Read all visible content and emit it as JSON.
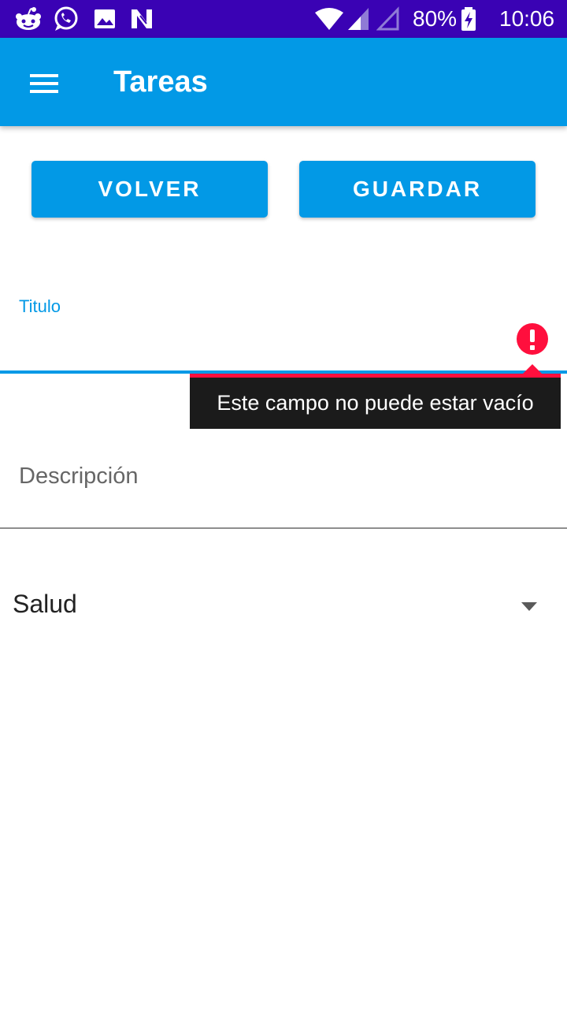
{
  "status_bar": {
    "battery": "80%",
    "time": "10:06",
    "icons": [
      "reddit-icon",
      "whatsapp-icon",
      "image-icon",
      "n-icon",
      "wifi-icon",
      "signal-icon",
      "signal-empty-icon",
      "battery-charging-icon"
    ]
  },
  "app_bar": {
    "title": "Tareas",
    "menu_icon": "hamburger-menu-icon"
  },
  "actions": {
    "back_label": "VOLVER",
    "save_label": "GUARDAR"
  },
  "form": {
    "title_label": "Titulo",
    "title_error": "Este campo no puede estar vacío",
    "description_placeholder": "Descripción",
    "category_value": "Salud"
  },
  "colors": {
    "accent": "#0299e6",
    "status_bar": "#3a02b4",
    "error": "#ff0f3d"
  }
}
